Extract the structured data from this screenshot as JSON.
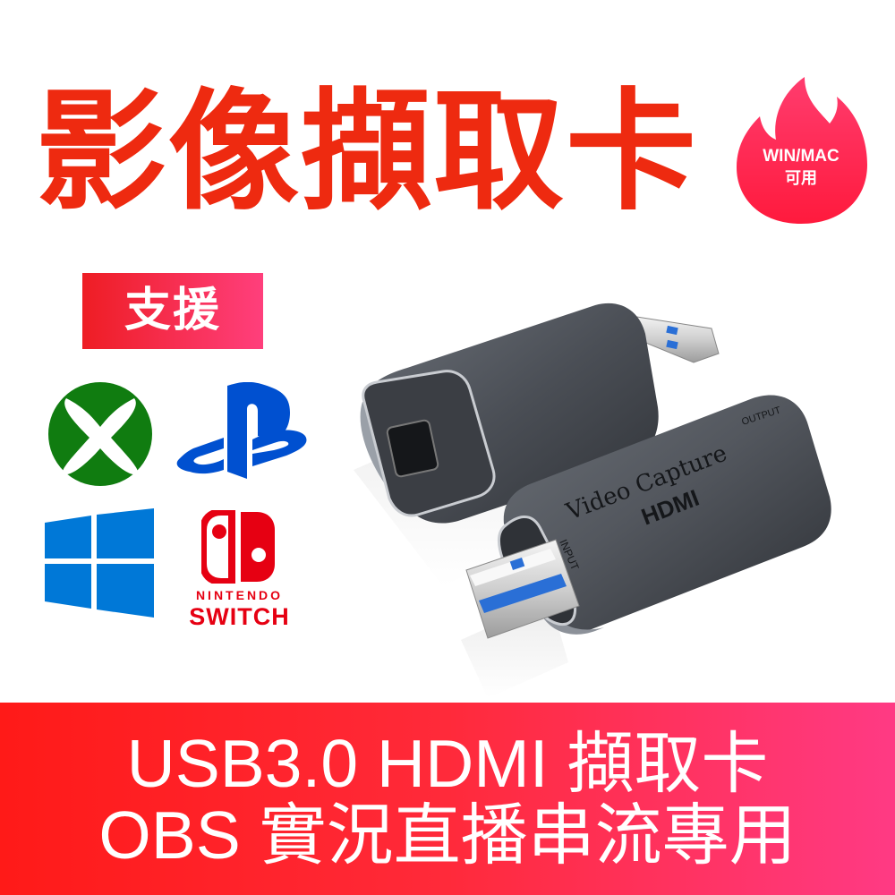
{
  "headline": "影像擷取卡",
  "badge": {
    "line1": "WIN/MAC",
    "line2": "可用",
    "color": "#ff2d55"
  },
  "support_label": "支援",
  "platforms": {
    "switch_line1": "NINTENDO",
    "switch_line2": "SWITCH"
  },
  "product": {
    "device_text": "Video Capture",
    "port_input": "INPUT",
    "port_output": "OUTPUT",
    "brand_mark": "HDMI"
  },
  "banner": {
    "line1": "USB3.0 HDMI 擷取卡",
    "line2": "OBS 實況直播串流專用"
  },
  "colors": {
    "headline": "#ee2a10",
    "xbox": "#107c10",
    "playstation": "#0050d0",
    "windows": "#0078d7",
    "nintendo": "#e60012"
  }
}
